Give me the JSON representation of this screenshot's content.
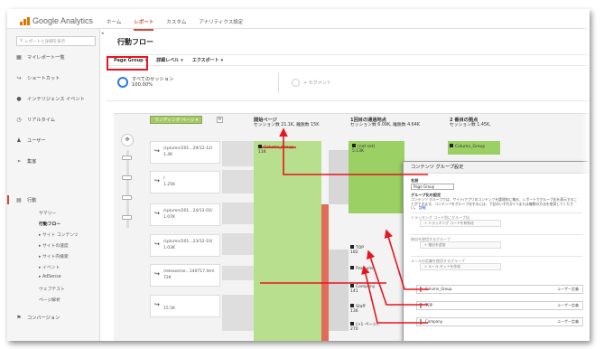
{
  "brand": {
    "product": "Google Analytics"
  },
  "nav": {
    "tabs": [
      "ホーム",
      "レポート",
      "カスタム",
      "アナリティクス設定"
    ],
    "active": 1
  },
  "sidebar": {
    "search_placeholder": "レポートと詳細を表示",
    "items": [
      {
        "label": "マイレポート一覧",
        "icon": "grid-icon"
      },
      {
        "label": "ショートカット",
        "icon": "shortcut-icon"
      },
      {
        "label": "インテリジェンス イベント",
        "icon": "bulb-icon"
      },
      {
        "label": "リアルタイム",
        "icon": "clock-icon"
      },
      {
        "label": "ユーザー",
        "icon": "users-icon"
      },
      {
        "label": "集客",
        "icon": "acquisition-icon"
      },
      {
        "label": "行動",
        "icon": "behavior-icon"
      },
      {
        "label": "コンバージョン",
        "icon": "flag-icon"
      }
    ],
    "sub_items": [
      "サマリー",
      "行動フロー",
      "サイト コンテンツ",
      "サイトの速度",
      "サイト内検索",
      "イベント",
      "AdSense",
      "ウェブテスト",
      "ページ解析"
    ],
    "sub_active": 1
  },
  "page": {
    "title": "行動フロー"
  },
  "toolbar": {
    "view": "Page Group",
    "detail": "詳細レベル",
    "export": "エクスポート"
  },
  "segments": {
    "all": "すべてのセッション",
    "all_pct": "100.00%",
    "add": "+ セグメント"
  },
  "flow": {
    "dimension": "ランディング ページ",
    "columns": [
      {
        "title": "開始ページ",
        "stats": "セッション数 21.1K, 離脱数 15K"
      },
      {
        "title": "1回目の通過地点",
        "stats": "セッション数 6.09K, 離脱数 4.64K"
      },
      {
        "title": "2 番目の拠点",
        "stats": "セッション数 1.45K,"
      }
    ],
    "start_nodes": [
      {
        "label": "/cplumn/201...29/12-12/",
        "value": "1.4K"
      },
      {
        "label": "/",
        "value": "1.25K"
      },
      {
        "label": "/cplumn/201...24/13-02/",
        "value": "1.07K"
      },
      {
        "label": "/cplumn/201...23/12-10/",
        "value": "1.03K"
      },
      {
        "label": "/release/se...140717.htm",
        "value": "72K"
      },
      {
        "label": "",
        "value": "15.5K"
      }
    ],
    "first_group": {
      "label": "Column_Group",
      "value": "11K"
    },
    "second_nodes": [
      {
        "label": "(not set)",
        "value": "5.13K"
      },
      {
        "label": "TOP",
        "value": "182"
      },
      {
        "label": "Products",
        "value": ""
      },
      {
        "label": "Company",
        "value": "141"
      },
      {
        "label": "Staff",
        "value": "136"
      },
      {
        "label": "(>1 ページ)",
        "value": "270"
      }
    ],
    "third_nodes": [
      {
        "label": "Column_Group",
        "value": ""
      }
    ]
  },
  "modal": {
    "title": "コンテンツ グループ設定",
    "name_label": "名前",
    "name_value": "Page Group",
    "settings_label": "グループ化の設定",
    "description": "コンテンツ グループでは、サイト/アプリのコンテンツを論理的に集め、レポートでグループ化を表示することができます。コンテンツをグループ化するには、下記のいずれか1つまたは複数の方法を使用してください。",
    "description_link": "詳細",
    "section1": "トラッキング コード別にグループ化",
    "section1_row": "トラッキング コードを有効化",
    "section2": "抽出を使用するグループ",
    "section2_row": "抽出を追加",
    "section3": "ルールの定義を使用するグループ",
    "section3_row": "ルール セットを作成",
    "groups": [
      {
        "name": "Column_Group",
        "action": "ユーザー定義"
      },
      {
        "name": "TOP",
        "action": "ユーザー定義"
      },
      {
        "name": "Company",
        "action": "ユーザー定義"
      }
    ]
  },
  "colors": {
    "accent": "#d14836",
    "highlight": "#e8141e",
    "green": "#b8df8d",
    "green_dark": "#9bd064",
    "segment_blue": "#2a7ae2"
  }
}
